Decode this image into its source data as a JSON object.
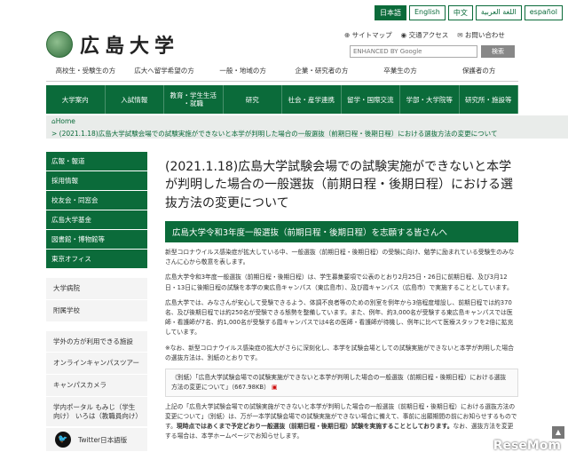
{
  "lang": [
    "日本語",
    "English",
    "中文",
    "اللغة العربية",
    "español"
  ],
  "site": {
    "name": "広島大学"
  },
  "util": [
    "サイトマップ",
    "交通アクセス",
    "お問い合わせ"
  ],
  "search": {
    "placeholder": "ENHANCED BY Google",
    "button": "検索"
  },
  "target_nav": [
    "高校生・受験生の方",
    "広大へ留学希望の方",
    "一般・地域の方",
    "企業・研究者の方",
    "卒業生の方",
    "保護者の方"
  ],
  "global_nav": [
    "大学案内",
    "入試情報",
    "教育・学生生活\n・就職",
    "研究",
    "社会・産学連携",
    "留学・国際交流",
    "学部・大学院等",
    "研究所・施設等"
  ],
  "breadcrumb": {
    "home": "Home",
    "path": "> (2021.1.18)広島大学試験会場での試験実施ができないと本学が判明した場合の一般選抜（前期日程・後期日程）における選抜方法の変更について"
  },
  "side": {
    "green": [
      "広報・報道",
      "採用情報",
      "校友会・同窓会",
      "広島大学基金",
      "図書館・博物館等",
      "東京オフィス"
    ],
    "grey1": [
      "大学病院",
      "附属学校"
    ],
    "grey2": [
      "学外の方が利用できる施設",
      "オンラインキャンパスツアー",
      "キャンパスカメラ",
      "学内ポータル もみじ（学生向け） いろは（教職員向け）"
    ]
  },
  "twitter": "Twitter日本語版",
  "main": {
    "title": "(2021.1.18)広島大学試験会場での試験実施ができないと本学が判明した場合の一般選抜（前期日程・後期日程）における選抜方法の変更について",
    "section": "広島大学令和3年度一般選抜（前期日程・後期日程）を志願する皆さんへ",
    "p1": "新型コロナウイルス感染症が拡大している中、一般選抜（前期日程・後期日程）の受験に向け、勉学に励まれている受験生のみなさんに心から敬意を表します。",
    "p2": "広島大学令和3年度一般選抜（前期日程・後期日程）は、学生募集要項で公表のとおり2月25日・26日に前期日程、及び3月12日・13日に後期日程の試験を本学の東広島キャンパス（東広島市）、及び霞キャンパス（広島市）で実施することとしています。",
    "p3": "広島大学では、みなさんが安心して受験できるよう、体調不良者等のための別室を例年から3倍程度増設し、前期日程では約370名、及び後期日程では約250名が受験できる態勢を整備しています。また、例年、約3,000名が受験する東広島キャンパスでは医師・看護師が7名、約1,000名が受験する霞キャンパスでは4名の医師・看護師が待機し、例年に比べて医療スタッフを2倍に拡充しています。",
    "p4": "※なお、新型コロナウイルス感染症の拡大がさらに深刻化し、本学を試験会場としての試験実施ができないと本学が判明した場合の選抜方法は、別紙のとおりです。",
    "link": "（別紙）「広島大学試験会場での試験実施ができないと本学が判明した場合の一般選抜（前期日程・後期日程）における選抜方法の変更について」（667.98KB）",
    "p5a": "上記の「広島大学試験会場での試験実施ができないと本学が判明した場合の一般選抜（前期日程・後期日程）における選抜方法の変更について」（別紙）は、万が一本学試験会場での試験実施ができない場合に備えて、事前に出願期間の前にお知らせするものです。",
    "p5b": "現時点ではあくまで予定どおり一般選抜（前期日程・後期日程）試験を実施することとしております。",
    "p5c": "なお、選抜方法を変更する場合は、本学ホームページでお知らせします。"
  },
  "watermark": "ReseMom"
}
